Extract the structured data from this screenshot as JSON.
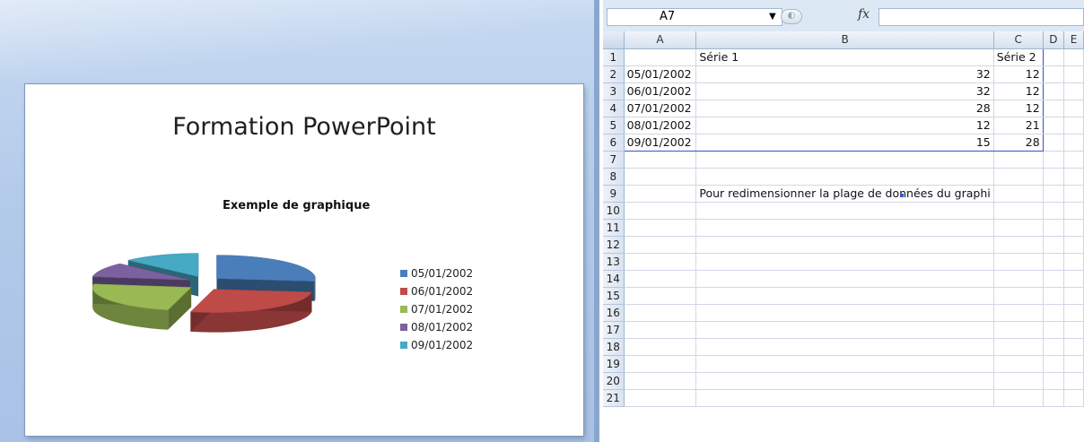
{
  "slide": {
    "title": "Formation PowerPoint",
    "chart_title": "Exemple de graphique"
  },
  "chart_data": {
    "type": "pie",
    "title": "Exemple de graphique",
    "categories": [
      "05/01/2002",
      "06/01/2002",
      "07/01/2002",
      "08/01/2002",
      "09/01/2002"
    ],
    "series": [
      {
        "name": "Série 1",
        "values": [
          32,
          32,
          28,
          12,
          15
        ]
      }
    ],
    "colors": [
      "#4a7ebb",
      "#be4b48",
      "#98b954",
      "#7d60a0",
      "#46aac5"
    ],
    "exploded": true,
    "three_d": true,
    "legend": "right"
  },
  "excel": {
    "name_box": "A7",
    "formula_icon": "fx",
    "formula_value": "",
    "columns": [
      "A",
      "B",
      "C",
      "D",
      "E"
    ],
    "rows": [
      {
        "n": "1",
        "a": "",
        "b": "Série 1",
        "c": "Série 2"
      },
      {
        "n": "2",
        "a": "05/01/2002",
        "b": "32",
        "c": "12"
      },
      {
        "n": "3",
        "a": "06/01/2002",
        "b": "32",
        "c": "12"
      },
      {
        "n": "4",
        "a": "07/01/2002",
        "b": "28",
        "c": "12"
      },
      {
        "n": "5",
        "a": "08/01/2002",
        "b": "12",
        "c": "21"
      },
      {
        "n": "6",
        "a": "09/01/2002",
        "b": "15",
        "c": "28"
      },
      {
        "n": "7",
        "a": "",
        "b": "",
        "c": ""
      },
      {
        "n": "8",
        "a": "",
        "b": "",
        "c": ""
      },
      {
        "n": "9",
        "a": "",
        "b": "Pour redimensionner la plage de données du graphi",
        "c": ""
      },
      {
        "n": "10"
      },
      {
        "n": "11"
      },
      {
        "n": "12"
      },
      {
        "n": "13"
      },
      {
        "n": "14"
      },
      {
        "n": "15"
      },
      {
        "n": "16"
      },
      {
        "n": "17"
      },
      {
        "n": "18"
      },
      {
        "n": "19"
      },
      {
        "n": "20"
      },
      {
        "n": "21"
      }
    ]
  }
}
